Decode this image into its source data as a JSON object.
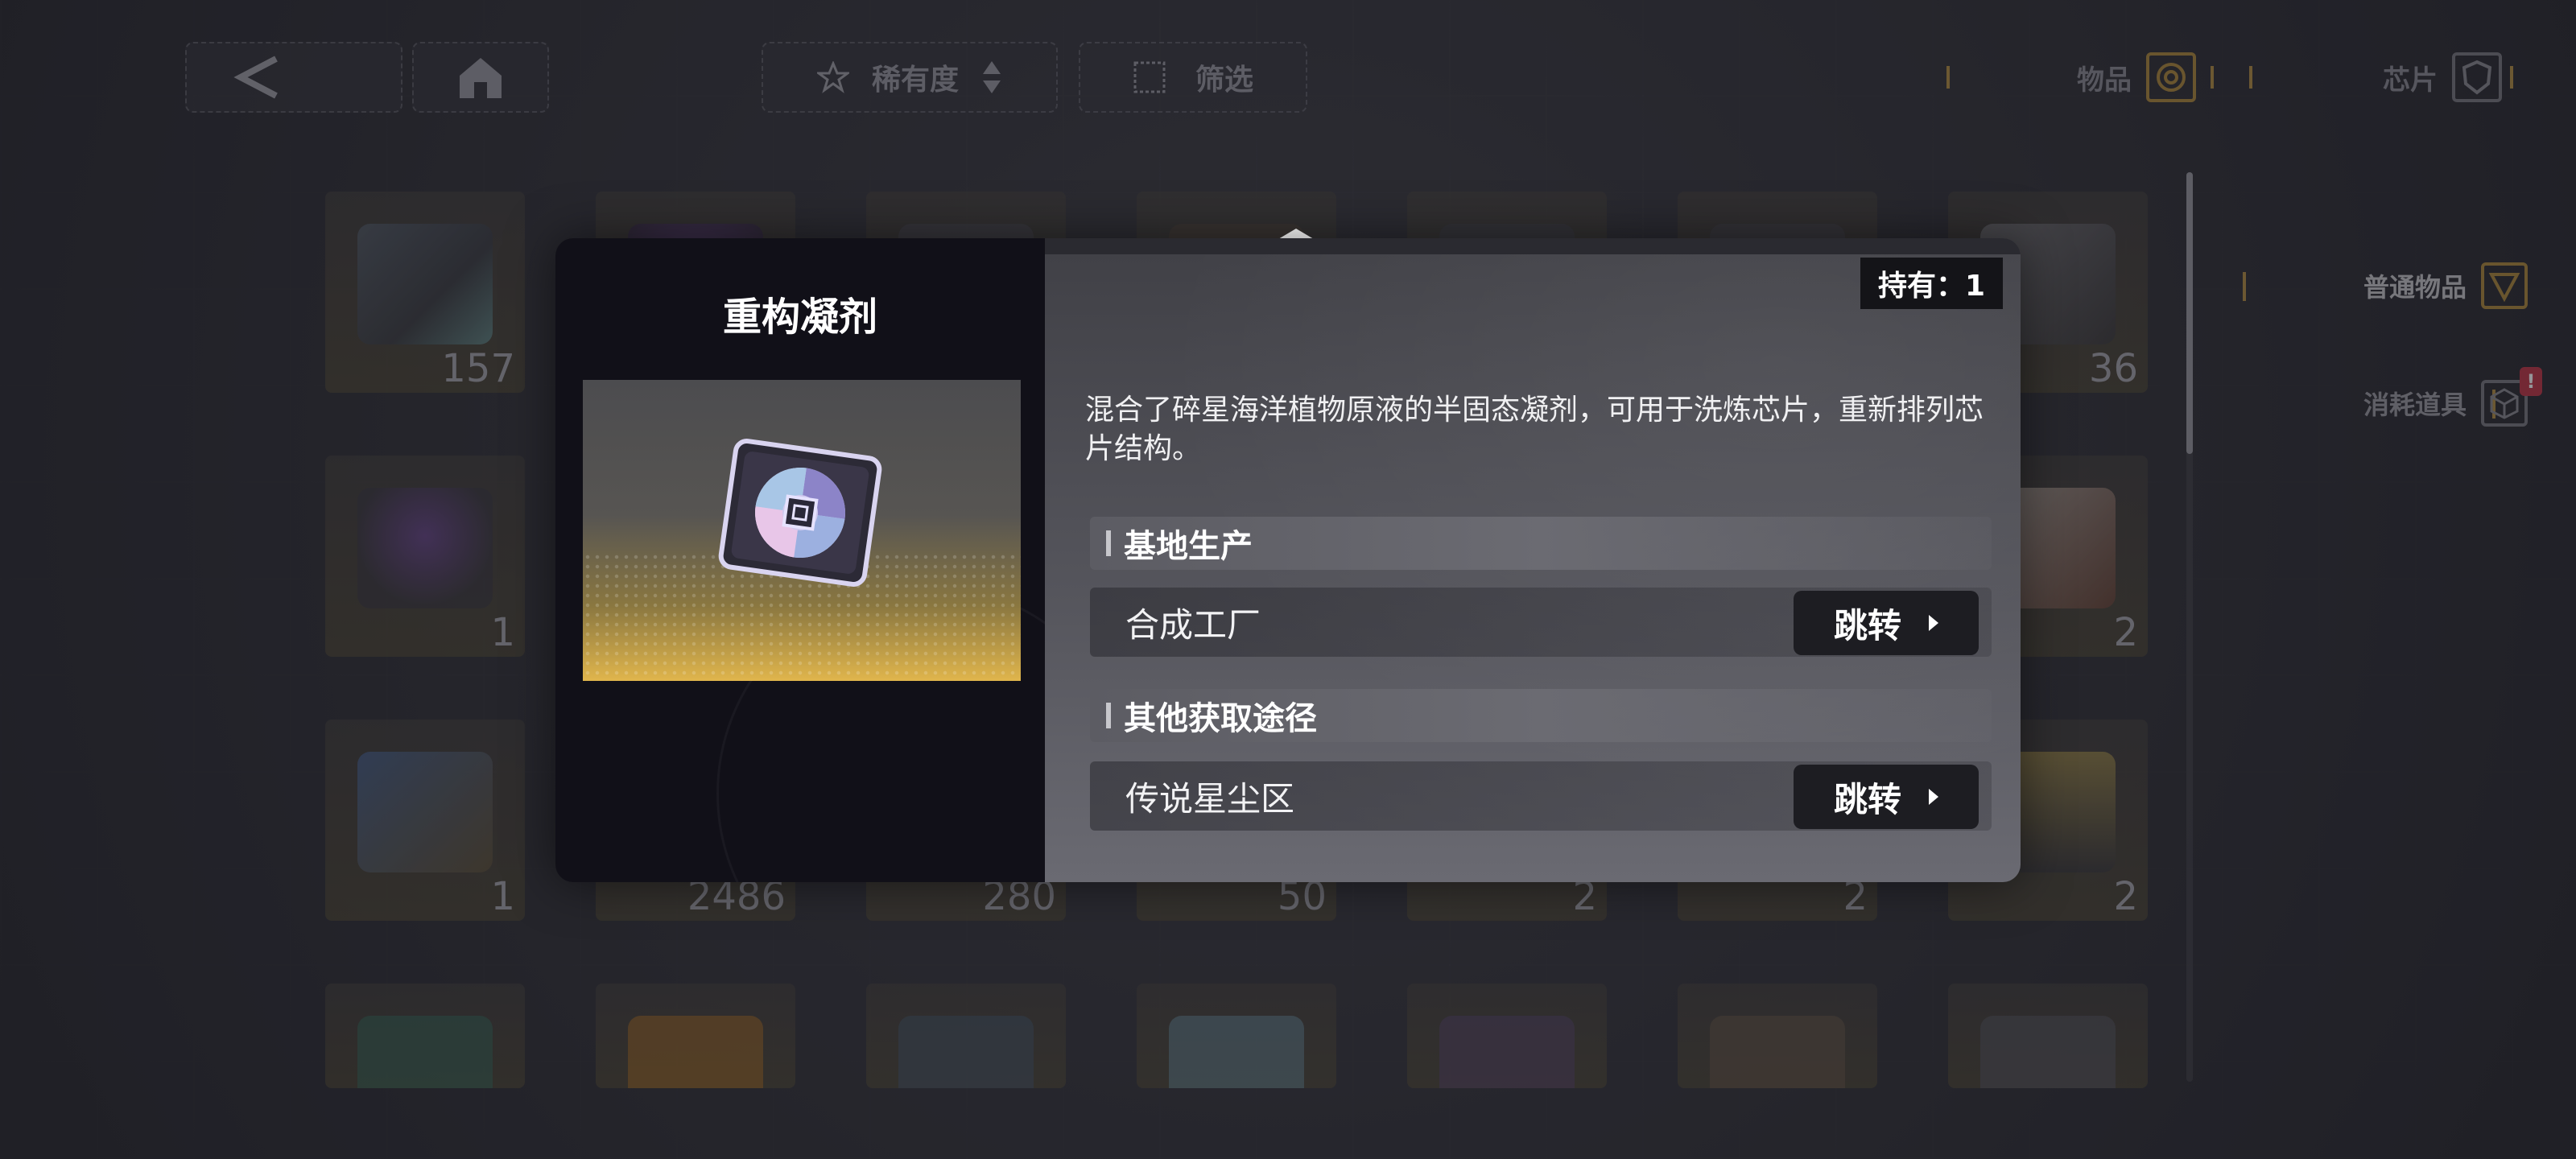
{
  "topbar": {
    "back_icon": "chevron-left-icon",
    "home_icon": "home-icon",
    "sort": {
      "label": "稀有度",
      "icon": "star-icon",
      "arrow_icon": "sort-arrows-icon"
    },
    "filter": {
      "label": "筛选",
      "icon": "filter-icon"
    },
    "tabs": [
      {
        "label": "物品",
        "icon": "items-icon"
      },
      {
        "label": "芯片",
        "icon": "chip-shield-icon"
      }
    ]
  },
  "sidebar": {
    "items": [
      {
        "label": "普通物品",
        "icon": "common-item-icon"
      },
      {
        "label": "消耗道具",
        "icon": "consumable-cube-icon",
        "badge": "!"
      }
    ]
  },
  "grid": {
    "row1": [
      "157",
      "36"
    ],
    "row2": [
      "1",
      "2"
    ],
    "row3": [
      "1",
      "2486",
      "280",
      "50",
      "2",
      "2",
      "2"
    ]
  },
  "modal": {
    "item_name": "重构凝剂",
    "owned": "持有：1",
    "description": "混合了碎星海洋植物原液的半固态凝剂，可用于洗炼芯片，重新排列芯片结构。",
    "sections": [
      {
        "title": "基地生产",
        "rows": [
          {
            "name": "合成工厂",
            "button": "跳转"
          }
        ]
      },
      {
        "title": "其他获取途径",
        "rows": [
          {
            "name": "传说星尘区",
            "button": "跳转"
          }
        ]
      }
    ]
  },
  "colors": {
    "accent_gold": "#b49145",
    "badge_red": "#c23a4a",
    "panel_dark": "#111018"
  }
}
